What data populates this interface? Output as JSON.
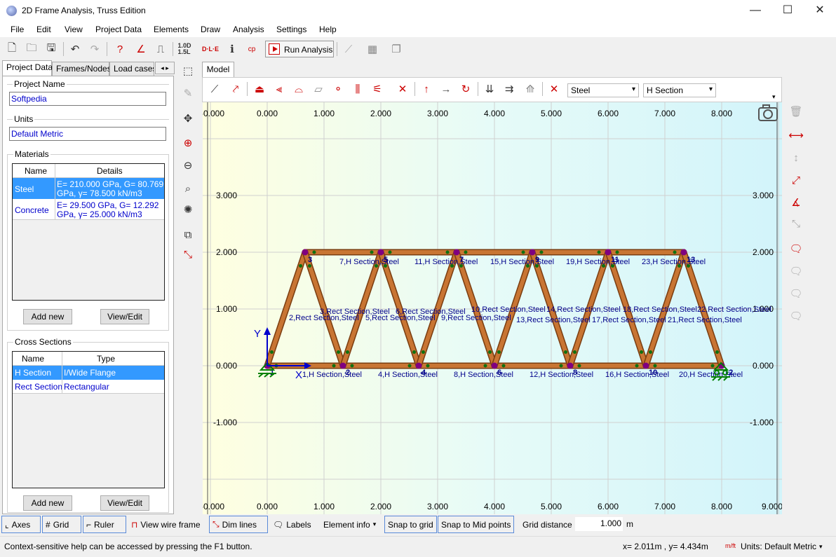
{
  "window": {
    "title": "2D Frame Analysis, Truss Edition",
    "min": "—",
    "max": "☐",
    "close": "✕"
  },
  "menu": [
    "File",
    "Edit",
    "View",
    "Project Data",
    "Elements",
    "Draw",
    "Analysis",
    "Settings",
    "Help"
  ],
  "toolbar": {
    "run_label": "Run Analysis",
    "load_combo": "1.0D\n1.5L",
    "dle": "D·L·E"
  },
  "left": {
    "tabs": [
      "Project Data",
      "Frames/Nodes",
      "Load cases"
    ],
    "project_name_label": "Project Name",
    "project_name": "Softpedia",
    "units_label": "Units",
    "units": "Default Metric",
    "materials_label": "Materials",
    "materials_headers": [
      "Name",
      "Details"
    ],
    "materials": [
      {
        "name": "Steel",
        "details1": "E= 210.000 GPa, G= 80.769",
        "details2": "GPa, γ= 78.500 kN/m3"
      },
      {
        "name": "Concrete",
        "details1": "E= 29.500 GPa, G= 12.292",
        "details2": "GPa, γ= 25.000 kN/m3"
      }
    ],
    "cross_label": "Cross Sections",
    "cross_headers": [
      "Name",
      "Type"
    ],
    "cross_sections": [
      {
        "name": "H Section",
        "type": "I/Wide Flange"
      },
      {
        "name": "Rect Section",
        "type": "Rectangular"
      }
    ],
    "add_new": "Add new",
    "view_edit": "View/Edit"
  },
  "model": {
    "tab": "Model",
    "material_select": "Steel",
    "section_select": "H Section",
    "x_ticks": [
      "-0.000",
      "0.000",
      "1.000",
      "2.000",
      "3.000",
      "4.000",
      "5.000",
      "6.000",
      "7.000",
      "8.000"
    ],
    "x_bottom_ticks": [
      "-0.000",
      "0.000",
      "1.000",
      "2.000",
      "3.000",
      "4.000",
      "5.000",
      "6.000",
      "7.000",
      "8.000",
      "9.000"
    ],
    "y_ticks": [
      "3.000",
      "2.000",
      "1.000",
      "0.000",
      "-1.000"
    ],
    "axis_x": "X",
    "axis_y": "Y",
    "node_labels": [
      "1",
      "2",
      "3",
      "4",
      "5",
      "6",
      "7",
      "8",
      "9",
      "10",
      "11",
      "12",
      "13"
    ],
    "chord_labels": [
      "7,H Section,Steel",
      "11,H Section,Steel",
      "15,H Section,Steel",
      "19,H Section,Steel",
      "23,H Section,Steel",
      "1,H Section,Steel",
      "4,H Section,Steel",
      "8,H Section,Steel",
      "12,H Section,Steel",
      "16,H Section,Steel",
      "20,H Section,Steel"
    ],
    "diag_labels": [
      "2,Rect Section,Steel",
      "3,Rect Section,Steel",
      "5,Rect Section,Steel",
      "6,Rect Section,Steel",
      "9,Rect Section,Steel",
      "10,Rect Section,Steel",
      "13,Rect Section,Steel",
      "14,Rect Section,Steel",
      "17,Rect Section,Steel",
      "18,Rect Section,Steel",
      "21,Rect Section,Steel",
      "22,Rect Section,Steel"
    ]
  },
  "bottom": {
    "axes": "Axes",
    "grid": "Grid",
    "ruler": "Ruler",
    "wire": "View wire frame",
    "dim": "Dim lines",
    "labels": "Labels",
    "element_info": "Element info",
    "snap_grid": "Snap to grid",
    "snap_mid": "Snap to Mid points",
    "grid_distance_label": "Grid distance",
    "grid_distance": "1.000",
    "grid_unit": "m"
  },
  "status": {
    "help": "Context-sensitive help can be accessed by pressing the F1 button.",
    "coords": "x= 2.011m , y= 4.434m",
    "units": "Units: Default Metric",
    "unit_icon": "m/ft"
  },
  "colors": {
    "member": "#c87533",
    "node": "#800080",
    "midpoint": "#107010",
    "label": "#00008b",
    "selection": "#3399ff"
  }
}
